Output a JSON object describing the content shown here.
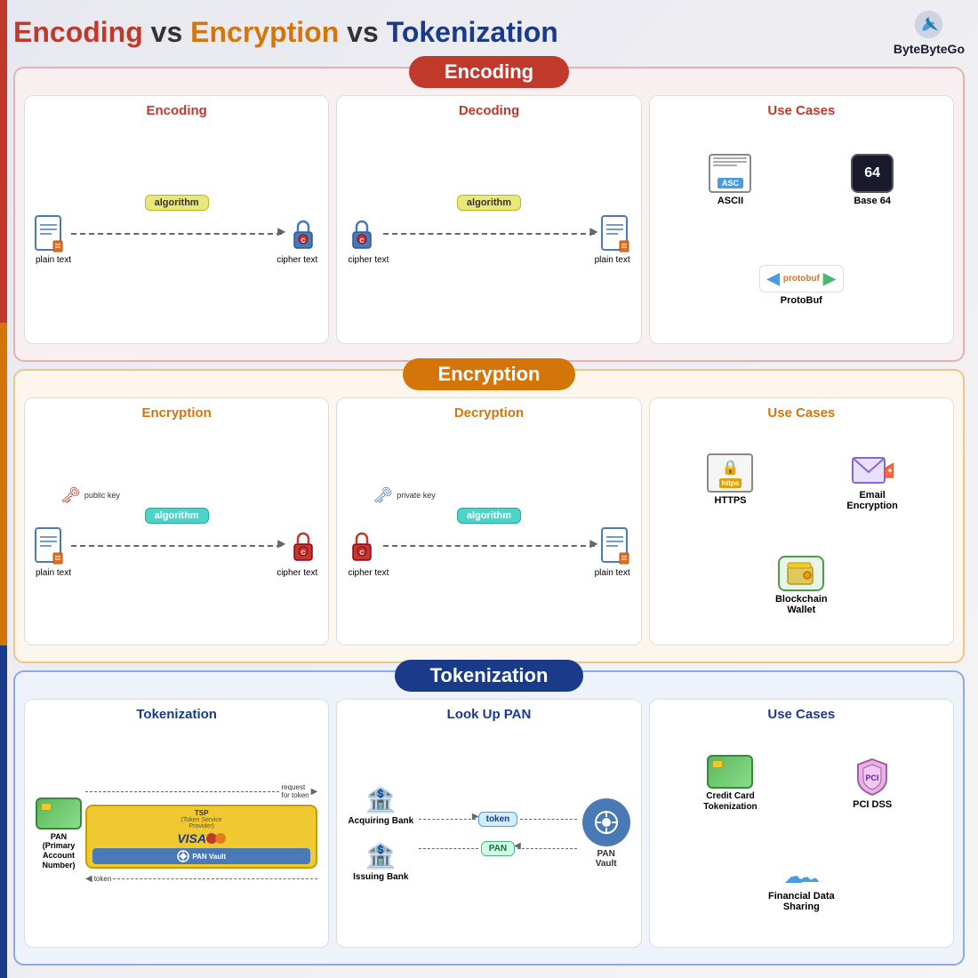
{
  "title": {
    "encoding": "Encoding",
    "vs1": " vs ",
    "encryption": "Encryption",
    "vs2": " vs ",
    "tokenization": "Tokenization"
  },
  "logo": {
    "text": "ByteByteGo"
  },
  "encoding_section": {
    "header": "Encoding",
    "encoding_panel": {
      "title": "Encoding",
      "algo": "algorithm",
      "plain_text": "plain text",
      "cipher_text": "cipher text"
    },
    "decoding_panel": {
      "title": "Decoding",
      "algo": "algorithm",
      "cipher_text": "cipher text",
      "plain_text": "plain text"
    },
    "use_cases_panel": {
      "title": "Use Cases",
      "items": [
        "ASCII",
        "Base 64",
        "ProtoBuf"
      ]
    }
  },
  "encryption_section": {
    "header": "Encryption",
    "encryption_panel": {
      "title": "Encryption",
      "algo": "algorithm",
      "public_key": "public key",
      "plain_text": "plain text",
      "cipher_text": "cipher text"
    },
    "decryption_panel": {
      "title": "Decryption",
      "algo": "algorithm",
      "private_key": "private key",
      "cipher_text": "cipher text",
      "plain_text": "plain text"
    },
    "use_cases_panel": {
      "title": "Use Cases",
      "items": [
        "HTTPS",
        "Email\nEncryption",
        "Blockchain\nWallet"
      ]
    }
  },
  "tokenization_section": {
    "header": "Tokenization",
    "tokenization_panel": {
      "title": "Tokenization",
      "pan_label": "PAN\n(Primary\nAccount\nNumber)",
      "request_for_token": "request\nfor token",
      "token_label": "token",
      "tsp_label": "TSP\n(Token Service\nProvider)",
      "pan_vault": "PAN\nVault"
    },
    "lookup_panel": {
      "title": "Look Up PAN",
      "token_label": "token",
      "pan_label": "PAN",
      "acquiring_bank": "Acquiring\nBank",
      "issuing_bank": "Issuing\nBank",
      "pan_vault": "PAN\nVault"
    },
    "use_cases_panel": {
      "title": "Use Cases",
      "items": [
        "Credit Card\nTokenization",
        "PCI DSS",
        "Financial Data\nSharing"
      ]
    }
  }
}
